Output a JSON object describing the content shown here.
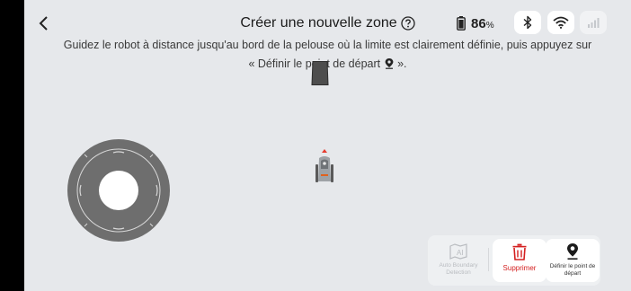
{
  "header": {
    "title": "Créer une nouvelle zone",
    "battery_value": "86",
    "battery_unit": "%"
  },
  "instruction": {
    "line1": "Guidez le robot à distance jusqu'au bord de la pelouse où la limite est clairement définie, puis appuyez sur",
    "line2": "« Définir le point de départ",
    "line2_end": "»."
  },
  "toolbar": {
    "auto_label": "Auto Boundary Detection",
    "delete_label": "Supprimer",
    "set_start_label": "Définir le point de départ"
  },
  "colors": {
    "background": "#e6e8eb",
    "delete_red": "#d42020",
    "disabled_grey": "#b9bcc0",
    "joystick_ring": "#6e6e6e"
  },
  "icons": {
    "back": "chevron-left",
    "help": "question-circle",
    "battery": "battery-high",
    "bluetooth": "bluetooth",
    "wifi": "wifi",
    "signal": "cellular-signal",
    "pin": "map-pin",
    "auto": "ai-map",
    "delete": "trash"
  }
}
